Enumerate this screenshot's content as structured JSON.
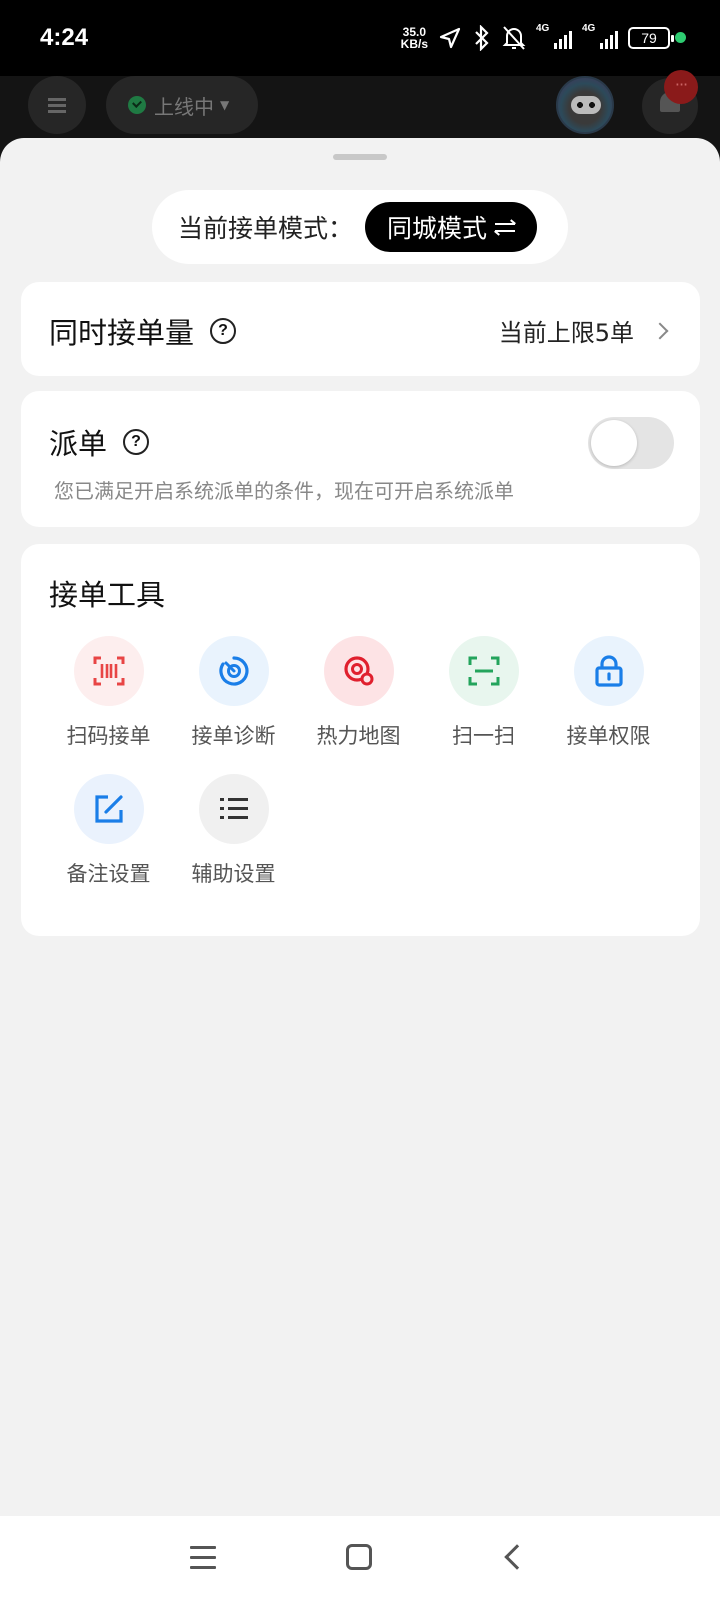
{
  "status_bar": {
    "time": "4:24",
    "net_speed_value": "35.0",
    "net_speed_unit": "KB/s",
    "signal1_type": "4G",
    "signal2_type": "4G",
    "battery": "79"
  },
  "header": {
    "online_status": "上线中",
    "notification_badge": "···"
  },
  "mode": {
    "label": "当前接单模式：",
    "value": "同城模式"
  },
  "concurrent": {
    "title": "同时接单量",
    "value": "当前上限5单"
  },
  "dispatch": {
    "title": "派单",
    "description": "您已满足开启系统派单的条件，现在可开启系统派单",
    "enabled": false
  },
  "tools": {
    "title": "接单工具",
    "items": [
      {
        "label": "扫码接单",
        "icon": "barcode-scan-icon",
        "color": "#e84545",
        "bg": "#fdeeee"
      },
      {
        "label": "接单诊断",
        "icon": "diagnosis-icon",
        "color": "#1a7ee8",
        "bg": "#e9f3fd"
      },
      {
        "label": "热力地图",
        "icon": "heatmap-pin-icon",
        "color": "#e0202e",
        "bg": "#fde3e5"
      },
      {
        "label": "扫一扫",
        "icon": "scan-frame-icon",
        "color": "#23a45c",
        "bg": "#e8f6ee"
      },
      {
        "label": "接单权限",
        "icon": "lock-icon",
        "color": "#1a7ee8",
        "bg": "#e9f3fd"
      },
      {
        "label": "备注设置",
        "icon": "edit-note-icon",
        "color": "#1a7ee8",
        "bg": "#eaf2fd"
      },
      {
        "label": "辅助设置",
        "icon": "list-icon",
        "color": "#333333",
        "bg": "#f0f0f0"
      }
    ]
  }
}
